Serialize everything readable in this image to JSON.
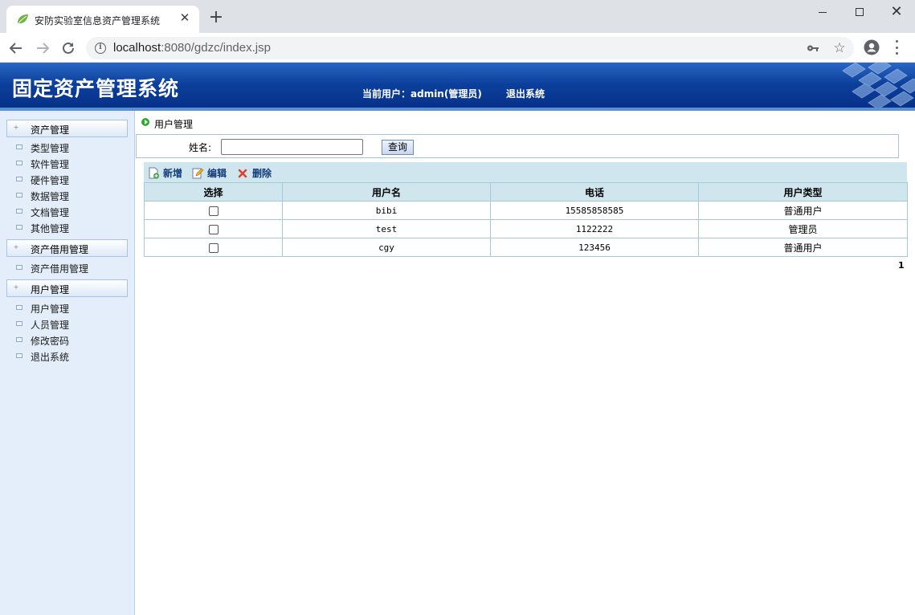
{
  "browser": {
    "tab_title": "安防实验室信息资产管理系统",
    "url_host": "localhost",
    "url_rest": ":8080/gdzc/index.jsp"
  },
  "header": {
    "system_title": "固定资产管理系统",
    "current_user": "当前用户：admin(管理员)",
    "logout": "退出系统"
  },
  "sidebar": {
    "groups": [
      {
        "label": "资产管理",
        "items": [
          "类型管理",
          "软件管理",
          "硬件管理",
          "数据管理",
          "文档管理",
          "其他管理"
        ]
      },
      {
        "label": "资产借用管理",
        "items": [
          "资产借用管理"
        ]
      },
      {
        "label": "用户管理",
        "items": [
          "用户管理",
          "人员管理",
          "修改密码",
          "退出系统"
        ]
      }
    ]
  },
  "main": {
    "breadcrumb": "用户管理",
    "search": {
      "label": "姓名:",
      "value": "",
      "placeholder": "",
      "button": "查询"
    },
    "toolbar": {
      "add": "新增",
      "edit": "编辑",
      "delete": "删除"
    },
    "table": {
      "columns": [
        "选择",
        "用户名",
        "电话",
        "用户类型"
      ],
      "rows": [
        {
          "checked": false,
          "username": "bibi",
          "phone": "15585858585",
          "type": "普通用户"
        },
        {
          "checked": false,
          "username": "test",
          "phone": "1122222",
          "type": "管理员"
        },
        {
          "checked": false,
          "username": "cgy",
          "phone": "123456",
          "type": "普通用户"
        }
      ]
    },
    "pager": "1"
  }
}
